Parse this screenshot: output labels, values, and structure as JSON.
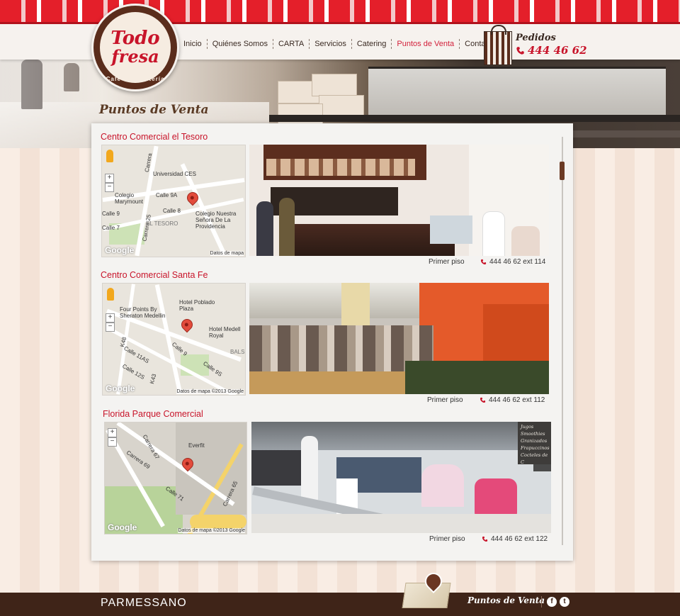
{
  "header": {
    "logo": {
      "line1": "Todo",
      "line2": "fresa",
      "tagline": "Café · Repostería"
    },
    "nav": [
      {
        "label": "Inicio",
        "active": false
      },
      {
        "label": "Quiénes Somos",
        "active": false
      },
      {
        "label": "CARTA",
        "active": false
      },
      {
        "label": "Servicios",
        "active": false
      },
      {
        "label": "Catering",
        "active": false
      },
      {
        "label": "Puntos de Venta",
        "active": true
      },
      {
        "label": "Contacto",
        "active": false
      }
    ],
    "orders": {
      "label": "Pedidos",
      "phone": "444 46 62"
    }
  },
  "page": {
    "title": "Puntos de Venta"
  },
  "stores": [
    {
      "name": "Centro Comercial el Tesoro",
      "floor": "Primer piso",
      "phone": "444 46 62 ext 114",
      "map_labels": [
        "Universidad CES",
        "Colegio Marymount",
        "Colegio Nuestra Señora De La Providencia",
        "EL TESORO",
        "Calle 9A",
        "Calle 9",
        "Calle 8",
        "Calle 7",
        "Carrera 25",
        "Carrera"
      ],
      "map_credit": "Datos de mapa",
      "map_brand": "Google"
    },
    {
      "name": "Centro Comercial Santa Fe",
      "floor": "Primer  piso",
      "phone": "444 46 62 ext 112",
      "map_labels": [
        "Four Points By Sheraton Medellin",
        "Hotel Poblado Plaza",
        "Hotel Medell Royal",
        "BALSO",
        "Calle 9",
        "Calle 9S",
        "Calle 11AS",
        "Calle 12S",
        "K48",
        "K43"
      ],
      "map_credit": "Datos de mapa ©2013 Google",
      "map_brand": "Google"
    },
    {
      "name": "Florida Parque Comercial",
      "floor": "Primer  piso",
      "phone": "444 46 62 ext 122",
      "map_labels": [
        "Everfit",
        "Carrera 69",
        "Carrera 67",
        "Calle 71",
        "Carrera 65"
      ],
      "map_credit": "Datos de mapa ©2013 Google",
      "map_brand": "Google",
      "menu_board": [
        "Jugos",
        "Smoothies",
        "Granizados",
        "Frapuccinos",
        "Cocteles de C"
      ]
    }
  ],
  "footer": {
    "brand": "PARMESSANO",
    "link": "Puntos de Venta",
    "social": [
      "f",
      "t"
    ]
  },
  "colors": {
    "accent": "#c8142a",
    "nav_active": "#d21f3a",
    "footer_bg": "#3f2418",
    "brown": "#5a2d1c"
  }
}
